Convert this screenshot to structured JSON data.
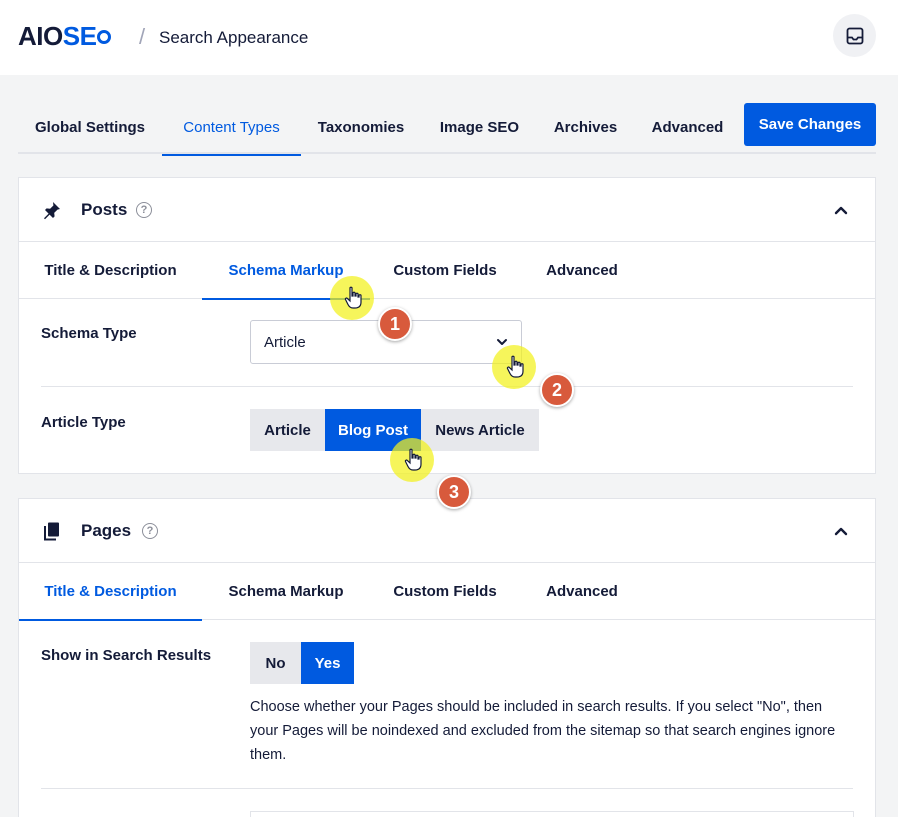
{
  "header": {
    "logo_part1": "AIO",
    "logo_part2": "SE",
    "separator": "/",
    "breadcrumb": "Search Appearance"
  },
  "main_tabs": [
    {
      "label": "Global Settings",
      "active": false
    },
    {
      "label": "Content Types",
      "active": true
    },
    {
      "label": "Taxonomies",
      "active": false
    },
    {
      "label": "Image SEO",
      "active": false
    },
    {
      "label": "Archives",
      "active": false
    },
    {
      "label": "Advanced",
      "active": false
    }
  ],
  "save_button": "Save Changes",
  "posts": {
    "title": "Posts",
    "help": "?",
    "tabs": [
      {
        "label": "Title & Description",
        "active": false
      },
      {
        "label": "Schema Markup",
        "active": true
      },
      {
        "label": "Custom Fields",
        "active": false
      },
      {
        "label": "Advanced",
        "active": false
      }
    ],
    "schema_type_label": "Schema Type",
    "schema_type_value": "Article",
    "article_type_label": "Article Type",
    "article_type_options": [
      "Article",
      "Blog Post",
      "News Article"
    ],
    "article_type_selected": "Blog Post"
  },
  "pages": {
    "title": "Pages",
    "help": "?",
    "tabs": [
      {
        "label": "Title & Description",
        "active": true
      },
      {
        "label": "Schema Markup",
        "active": false
      },
      {
        "label": "Custom Fields",
        "active": false
      },
      {
        "label": "Advanced",
        "active": false
      }
    ],
    "show_in_search_label": "Show in Search Results",
    "toggle_options": [
      "No",
      "Yes"
    ],
    "toggle_selected": "Yes",
    "show_in_search_desc": "Choose whether your Pages should be included in search results. If you select \"No\", then your Pages will be noindexed and excluded from the sitemap so that search engines ignore them."
  },
  "steps": [
    "1",
    "2",
    "3"
  ],
  "colors": {
    "accent": "#005ae0",
    "step_badge": "#d85a3c",
    "cursor_highlight": "#f2f11c"
  }
}
